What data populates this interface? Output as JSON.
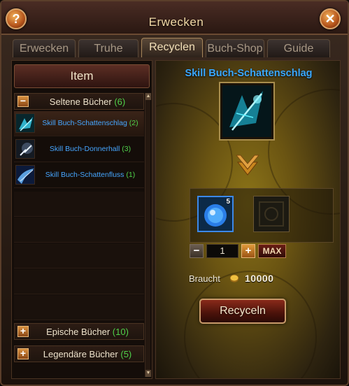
{
  "window": {
    "title": "Erwecken"
  },
  "tabs": [
    {
      "label": "Erwecken",
      "active": false
    },
    {
      "label": "Truhe",
      "active": false
    },
    {
      "label": "Recyclen",
      "active": true
    },
    {
      "label": "Buch-Shop",
      "active": false
    },
    {
      "label": "Guide",
      "active": false
    }
  ],
  "left": {
    "header": "Item",
    "categories": [
      {
        "label": "Seltene Bücher",
        "count": "(6)",
        "toggle": "−"
      },
      {
        "label": "Epische Bücher",
        "count": "(10)",
        "toggle": "+"
      },
      {
        "label": "Legendäre Bücher",
        "count": "(5)",
        "toggle": "+"
      }
    ],
    "books": [
      {
        "name": "Skill Buch-Schattenschlag",
        "count": "(2)",
        "icon": "shadow-strike-book-icon"
      },
      {
        "name": "Skill Buch-Donnerhall",
        "count": "(3)",
        "icon": "thunder-book-icon"
      },
      {
        "name": "Skill Buch-Schattenfluss",
        "count": "(1)",
        "icon": "shadow-flow-book-icon"
      }
    ]
  },
  "right": {
    "skill_title": "Skill Buch-Schattenschlag",
    "slot_stack": "5",
    "quantity": "1",
    "max_label": "MAX",
    "cost_label": "Braucht",
    "cost_value": "10000",
    "recycle_label": "Recyceln"
  },
  "colors": {
    "accent_blue": "#3aa8ff",
    "count_green": "#4fd04a",
    "gold": "#a88d4e"
  }
}
